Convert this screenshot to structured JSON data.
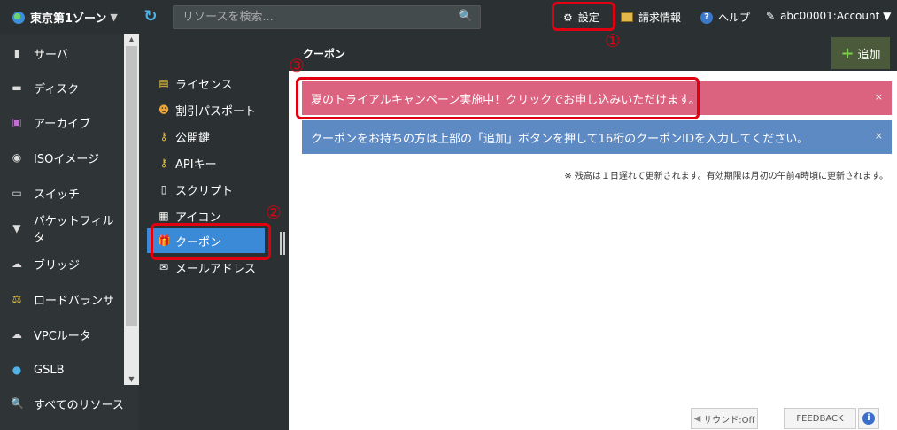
{
  "topbar": {
    "zone": "東京第1ゾーン",
    "zone_caret": "▼",
    "refresh_icon": "↻",
    "search_placeholder": "リソースを検索...",
    "search_icon": "🔍",
    "settings": "設定",
    "billing": "請求情報",
    "help": "ヘルプ",
    "account": "abc00001:Account ▼"
  },
  "annotations": {
    "one": "①",
    "two": "②",
    "three": "③"
  },
  "sidebar": {
    "items": [
      {
        "icon": "▮",
        "label": "サーバ"
      },
      {
        "icon": "▬",
        "label": "ディスク"
      },
      {
        "icon": "▣",
        "label": "アーカイブ"
      },
      {
        "icon": "◉",
        "label": "ISOイメージ"
      },
      {
        "icon": "▭",
        "label": "スイッチ"
      },
      {
        "icon": "▼",
        "label": "パケットフィルタ"
      },
      {
        "icon": "☁",
        "label": "ブリッジ"
      },
      {
        "icon": "⚖",
        "label": "ロードバランサ"
      },
      {
        "icon": "☁",
        "label": "VPCルータ"
      },
      {
        "icon": "●",
        "label": "GSLB"
      },
      {
        "icon": "🔍",
        "label": "すべてのリソース"
      }
    ]
  },
  "submenu": {
    "items": [
      {
        "icon": "▤",
        "label": "ライセンス",
        "color": "#e8c23a"
      },
      {
        "icon": "☻",
        "label": "割引パスポート",
        "color": "#e8a33a"
      },
      {
        "icon": "⚷",
        "label": "公開鍵",
        "color": "#e8c23a"
      },
      {
        "icon": "⚷",
        "label": "APIキー",
        "color": "#e8c23a"
      },
      {
        "icon": "▯",
        "label": "スクリプト",
        "color": "#ffffff"
      },
      {
        "icon": "▦",
        "label": "アイコン",
        "color": "#dddddd"
      },
      {
        "icon": "🎁",
        "label": "クーポン",
        "color": "#e84a4a"
      },
      {
        "icon": "✉",
        "label": "メールアドレス",
        "color": "#dddddd"
      }
    ]
  },
  "main": {
    "title": "クーポン",
    "add_label": "追加",
    "add_plus": "+",
    "alert_pink": "夏のトライアルキャンペーン実施中！クリックでお申し込みいただけます。",
    "alert_blue": "クーポンをお持ちの方は上部の「追加」ボタンを押して16桁のクーポンIDを入力してください。",
    "close": "×",
    "note": "※ 残高は１日遅れて更新されます。有効期限は月初の午前4時頃に更新されます。"
  },
  "footer": {
    "sound": "サウンド:Off",
    "feedback": "FEEDBACK",
    "info": "i"
  }
}
